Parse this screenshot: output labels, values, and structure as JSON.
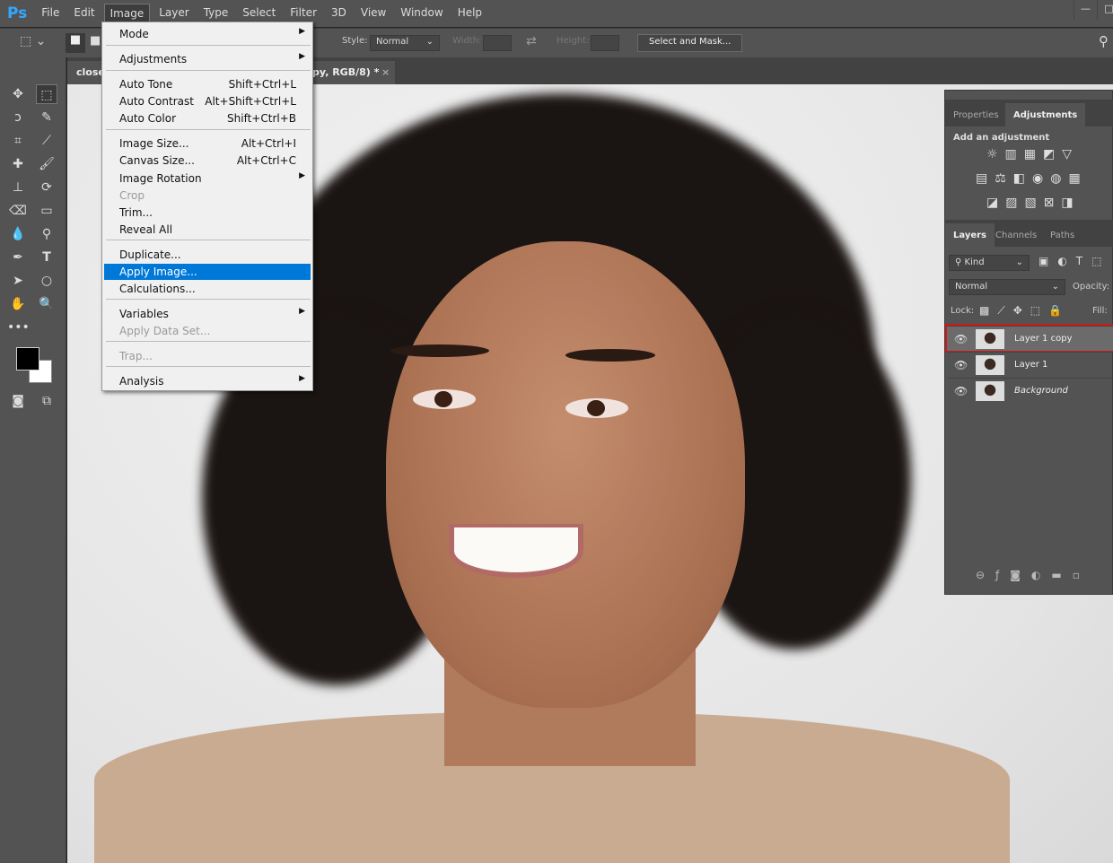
{
  "app": {
    "logo": "Ps",
    "menu": [
      "File",
      "Edit",
      "Image",
      "Layer",
      "Type",
      "Select",
      "Filter",
      "3D",
      "View",
      "Window",
      "Help"
    ],
    "open_menu": "Image",
    "window_controls": [
      "minimize",
      "maximize"
    ]
  },
  "options": {
    "style_label": "Style:",
    "style_value": "Normal",
    "width_label": "Width:",
    "height_label": "Height:",
    "select_mask": "Select and Mask..."
  },
  "document": {
    "tab_left": "close",
    "tab_right": "py, RGB/8) *",
    "close": "×"
  },
  "image_menu": [
    {
      "label": "Mode",
      "submenu": true
    },
    {
      "sep": true
    },
    {
      "label": "Adjustments",
      "submenu": true
    },
    {
      "sep": true
    },
    {
      "label": "Auto Tone",
      "shortcut": "Shift+Ctrl+L"
    },
    {
      "label": "Auto Contrast",
      "shortcut": "Alt+Shift+Ctrl+L"
    },
    {
      "label": "Auto Color",
      "shortcut": "Shift+Ctrl+B"
    },
    {
      "sep": true
    },
    {
      "label": "Image Size...",
      "shortcut": "Alt+Ctrl+I"
    },
    {
      "label": "Canvas Size...",
      "shortcut": "Alt+Ctrl+C"
    },
    {
      "label": "Image Rotation",
      "submenu": true
    },
    {
      "label": "Crop",
      "disabled": true
    },
    {
      "label": "Trim..."
    },
    {
      "label": "Reveal All"
    },
    {
      "sep": true
    },
    {
      "label": "Duplicate..."
    },
    {
      "label": "Apply Image...",
      "highlighted": true
    },
    {
      "label": "Calculations..."
    },
    {
      "sep": true
    },
    {
      "label": "Variables",
      "submenu": true
    },
    {
      "label": "Apply Data Set...",
      "disabled": true
    },
    {
      "sep": true
    },
    {
      "label": "Trap...",
      "disabled": true
    },
    {
      "sep": true
    },
    {
      "label": "Analysis",
      "submenu": true
    }
  ],
  "panel": {
    "top_tabs": [
      "Properties",
      "Adjustments"
    ],
    "active_top": "Adjustments",
    "add_adjustment": "Add an adjustment",
    "layer_tabs": [
      "Layers",
      "Channels",
      "Paths"
    ],
    "kind": "Kind",
    "blend": "Normal",
    "opacity_label": "Opacity:",
    "lock_label": "Lock:",
    "fill_label": "Fill:",
    "layers": [
      {
        "name": "Layer 1 copy",
        "selected": true
      },
      {
        "name": "Layer 1"
      },
      {
        "name": "Background",
        "italic": true
      }
    ]
  },
  "colors": {
    "accent": "#0078d7",
    "highlight_border": "#d01818",
    "ui_bg": "#535353"
  }
}
